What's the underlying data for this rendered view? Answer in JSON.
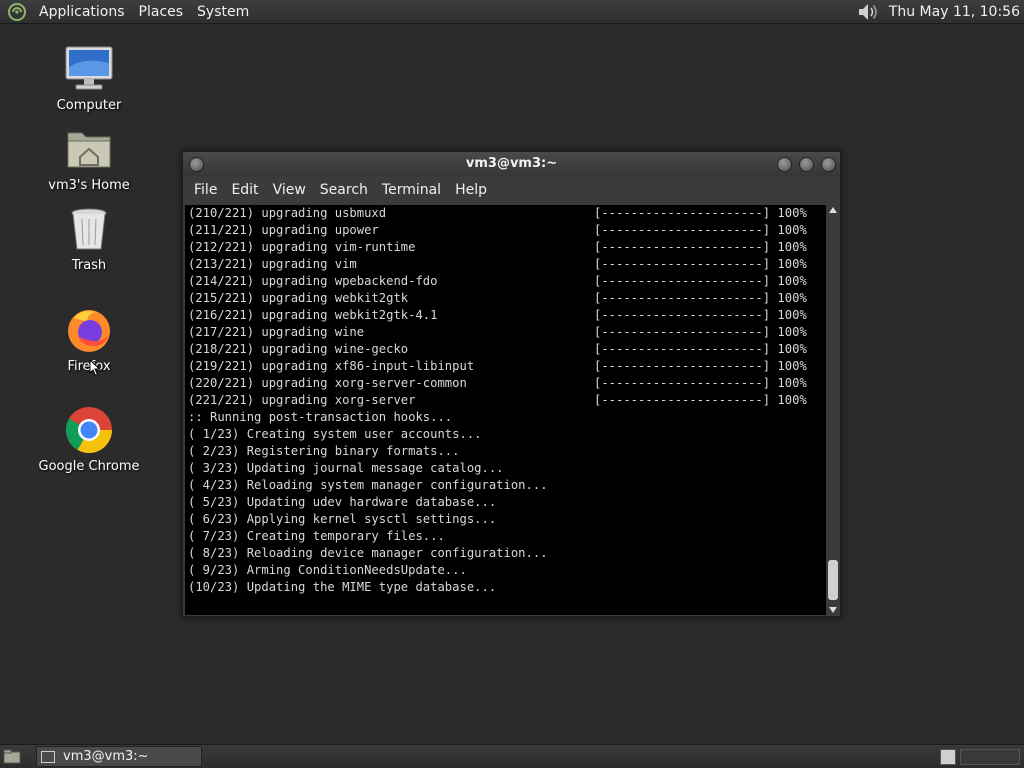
{
  "top_panel": {
    "menus": [
      "Applications",
      "Places",
      "System"
    ],
    "clock": "Thu May 11, 10:56",
    "icons": [
      "distro-logo-icon",
      "volume-icon"
    ]
  },
  "desktop": {
    "icons": [
      {
        "label": "Computer",
        "icon": "computer-icon"
      },
      {
        "label": "vm3's Home",
        "icon": "home-folder-icon"
      },
      {
        "label": "Trash",
        "icon": "trash-icon"
      },
      {
        "label": "Firefox",
        "icon": "firefox-icon"
      },
      {
        "label": "Google Chrome",
        "icon": "chrome-icon"
      }
    ]
  },
  "terminal": {
    "title": "vm3@vm3:~",
    "menus": [
      "File",
      "Edit",
      "View",
      "Search",
      "Terminal",
      "Help"
    ],
    "lines": [
      {
        "text": "(210/221) upgrading usbmuxd",
        "progress": "[----------------------] 100%"
      },
      {
        "text": "(211/221) upgrading upower",
        "progress": "[----------------------] 100%"
      },
      {
        "text": "(212/221) upgrading vim-runtime",
        "progress": "[----------------------] 100%"
      },
      {
        "text": "(213/221) upgrading vim",
        "progress": "[----------------------] 100%"
      },
      {
        "text": "(214/221) upgrading wpebackend-fdo",
        "progress": "[----------------------] 100%"
      },
      {
        "text": "(215/221) upgrading webkit2gtk",
        "progress": "[----------------------] 100%"
      },
      {
        "text": "(216/221) upgrading webkit2gtk-4.1",
        "progress": "[----------------------] 100%"
      },
      {
        "text": "(217/221) upgrading wine",
        "progress": "[----------------------] 100%"
      },
      {
        "text": "(218/221) upgrading wine-gecko",
        "progress": "[----------------------] 100%"
      },
      {
        "text": "(219/221) upgrading xf86-input-libinput",
        "progress": "[----------------------] 100%"
      },
      {
        "text": "(220/221) upgrading xorg-server-common",
        "progress": "[----------------------] 100%"
      },
      {
        "text": "(221/221) upgrading xorg-server",
        "progress": "[----------------------] 100%"
      },
      {
        "text": ":: Running post-transaction hooks...",
        "progress": ""
      },
      {
        "text": "( 1/23) Creating system user accounts...",
        "progress": ""
      },
      {
        "text": "( 2/23) Registering binary formats...",
        "progress": ""
      },
      {
        "text": "( 3/23) Updating journal message catalog...",
        "progress": ""
      },
      {
        "text": "( 4/23) Reloading system manager configuration...",
        "progress": ""
      },
      {
        "text": "( 5/23) Updating udev hardware database...",
        "progress": ""
      },
      {
        "text": "( 6/23) Applying kernel sysctl settings...",
        "progress": ""
      },
      {
        "text": "( 7/23) Creating temporary files...",
        "progress": ""
      },
      {
        "text": "( 8/23) Reloading device manager configuration...",
        "progress": ""
      },
      {
        "text": "( 9/23) Arming ConditionNeedsUpdate...",
        "progress": ""
      },
      {
        "text": "(10/23) Updating the MIME type database...",
        "progress": ""
      }
    ]
  },
  "taskbar": {
    "tasks": [
      {
        "label": "vm3@vm3:~",
        "icon": "terminal-icon"
      }
    ]
  },
  "colors": {
    "desktop_bg": "#2b2b2b",
    "terminal_bg": "#000000",
    "terminal_fg": "#d8d8d8"
  }
}
